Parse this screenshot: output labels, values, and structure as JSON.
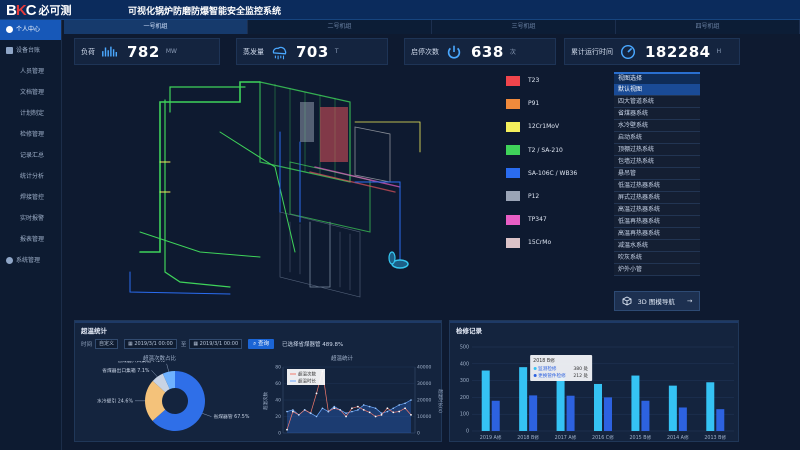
{
  "header": {
    "logo_text": "BKC",
    "logo_cn": "必可测",
    "title": "可视化锅炉防磨防爆智能安全监控系统"
  },
  "unit_tabs": [
    "一号机组",
    "二号机组",
    "三号机组",
    "四号机组"
  ],
  "sidebar": {
    "items": [
      {
        "label": "个人中心",
        "icon": "user-icon"
      },
      {
        "label": "设备台账",
        "icon": "device-icon"
      },
      {
        "label": "人员管理"
      },
      {
        "label": "文档管理"
      },
      {
        "label": "计划制定"
      },
      {
        "label": "检修管理"
      },
      {
        "label": "记录汇总"
      },
      {
        "label": "统计分析"
      },
      {
        "label": "焊接管控"
      },
      {
        "label": "实时报警"
      },
      {
        "label": "报表管理"
      },
      {
        "label": "系统管理",
        "icon": "gear-icon"
      }
    ]
  },
  "kpis": [
    {
      "label": "负荷",
      "value": "782",
      "unit": "MW",
      "icon": "load-wave-icon"
    },
    {
      "label": "蒸发量",
      "value": "703",
      "unit": "T",
      "icon": "steam-cloud-icon"
    },
    {
      "label": "启停次数",
      "value": "638",
      "unit": "次",
      "icon": "power-icon"
    },
    {
      "label": "累计运行时间",
      "value": "182284",
      "unit": "H",
      "icon": "gauge-icon"
    }
  ],
  "legend": [
    {
      "label": "T23",
      "color": "#f0454c"
    },
    {
      "label": "P91",
      "color": "#f08a3c"
    },
    {
      "label": "12Cr1MoV",
      "color": "#f4ef5c"
    },
    {
      "label": "T2 / SA-210",
      "color": "#3fd35a"
    },
    {
      "label": "SA-106C / WB36",
      "color": "#2a6cf0"
    },
    {
      "label": "P12",
      "color": "#9aa4b6"
    },
    {
      "label": "TP347",
      "color": "#e85ec4"
    },
    {
      "label": "15CrMo",
      "color": "#dcc3c8"
    }
  ],
  "view_panel": {
    "title": "视图选择",
    "items": [
      "默认视图",
      "四大管道系统",
      "省煤器系统",
      "水冷壁系统",
      "启动系统",
      "顶棚过热系统",
      "包墙过热系统",
      "悬吊管",
      "低温过热器系统",
      "屏式过热器系统",
      "高温过热器系统",
      "低温再热器系统",
      "高温再热器系统",
      "减温水系统",
      "吹灰系统",
      "炉外小管"
    ],
    "selected_index": 0,
    "nav_label": "3D 图模导航",
    "nav_icon": "cube-icon"
  },
  "stats": {
    "title": "超温统计",
    "filter": {
      "time_label": "时间",
      "mode": "自定义",
      "start": "2019/3/1 00:00",
      "to": "至",
      "end": "2019/3/1 00:00",
      "query": "查询",
      "summary": "已选择省煤器管 489.8%"
    },
    "pie": {
      "title": "超温次数占比",
      "slices": [
        {
          "label": "省煤器管 67.5%",
          "value": 67.5,
          "color": "#2f6fe8"
        },
        {
          "label": "水冷壁引 24.6%",
          "value": 24.6,
          "color": "#f4c27a"
        },
        {
          "label": "省煤器出口集箱 7.1%",
          "value": 7.1,
          "color": "#c8d3e4"
        },
        {
          "label": "省煤器入口集箱 7.1%",
          "value": 7.1,
          "color": "#6fb2ff"
        }
      ]
    },
    "line": {
      "title": "超温统计",
      "y_left_label": "超温次数",
      "y_right_label": "超温时长(s)",
      "left_ticks": [
        "0",
        "20",
        "40",
        "60",
        "80"
      ],
      "right_ticks": [
        "0",
        "10000",
        "20000",
        "30000",
        "40000"
      ],
      "series": [
        {
          "name": "超温次数",
          "color": "#f27a6d",
          "values": [
            4,
            26,
            22,
            28,
            24,
            48,
            75,
            26,
            30,
            28,
            20,
            30,
            32,
            28,
            25,
            20,
            22,
            30,
            25,
            26,
            30,
            22
          ]
        },
        {
          "name": "超温时长",
          "color": "#6aa8ff",
          "values": [
            13000,
            14000,
            11000,
            14000,
            12000,
            10000,
            15000,
            13000,
            16000,
            14000,
            12000,
            13000,
            14000,
            17000,
            16000,
            15000,
            12000,
            13000,
            15000,
            17000,
            18000,
            20000
          ]
        }
      ]
    }
  },
  "records": {
    "title": "检修记录",
    "tooltip": {
      "title": "2018 B修",
      "rows": [
        {
          "name": "监测检修",
          "value": "380 处"
        },
        {
          "name": "更换管件检修",
          "value": "212 处"
        }
      ]
    },
    "chart_data": {
      "type": "bar",
      "categories": [
        "2019 A修",
        "2018 B修",
        "2017 A修",
        "2016 C修",
        "2015 B修",
        "2014 A修",
        "2013 B修"
      ],
      "series": [
        {
          "name": "监测检修",
          "color": "#35c3f4",
          "values": [
            360,
            380,
            320,
            280,
            330,
            270,
            290
          ]
        },
        {
          "name": "更换管件检修",
          "color": "#2d62e0",
          "values": [
            180,
            212,
            210,
            200,
            180,
            140,
            130
          ]
        }
      ],
      "ylim": [
        0,
        500
      ],
      "yticks": [
        "0",
        "100",
        "200",
        "300",
        "400",
        "500"
      ]
    }
  }
}
